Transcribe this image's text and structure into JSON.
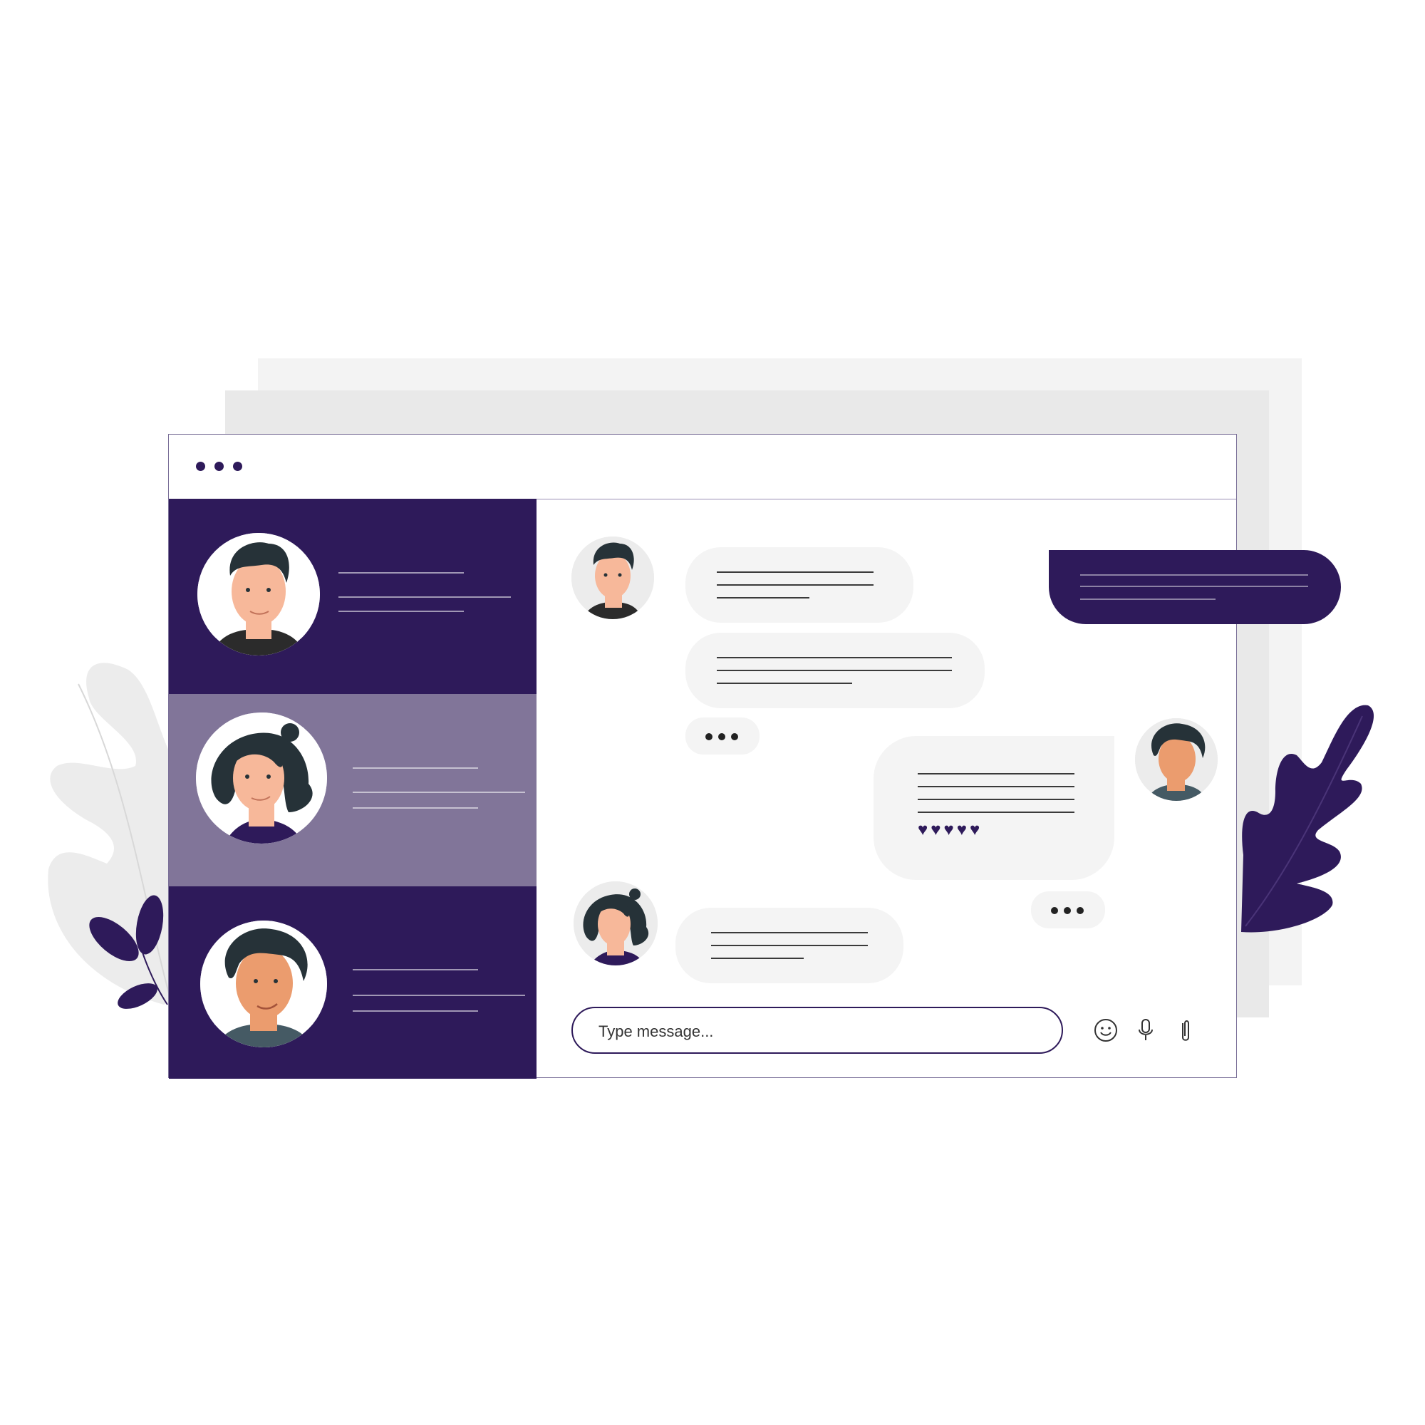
{
  "window": {
    "title_dots": [
      "dot-1",
      "dot-2",
      "dot-3"
    ]
  },
  "contacts": [
    {
      "avatar": "man-curly-hair-avatar",
      "state": "default"
    },
    {
      "avatar": "woman-bun-hair-avatar",
      "state": "selected"
    },
    {
      "avatar": "man-wavy-hair-avatar",
      "state": "default"
    }
  ],
  "chat": {
    "message_input": {
      "placeholder": "Type message..."
    },
    "typing_indicator": "•••",
    "reaction_icons": [
      "heart-icon",
      "heart-icon",
      "heart-icon",
      "heart-icon",
      "heart-icon"
    ],
    "toolbar_icons": [
      "smiley-icon",
      "microphone-icon",
      "paperclip-icon"
    ]
  },
  "colors": {
    "primary": "#2e1a5a",
    "selected": "#817599",
    "bubble": "#f4f4f4",
    "back_sheet_1": "#f3f3f3",
    "back_sheet_2": "#e9e9e9"
  }
}
